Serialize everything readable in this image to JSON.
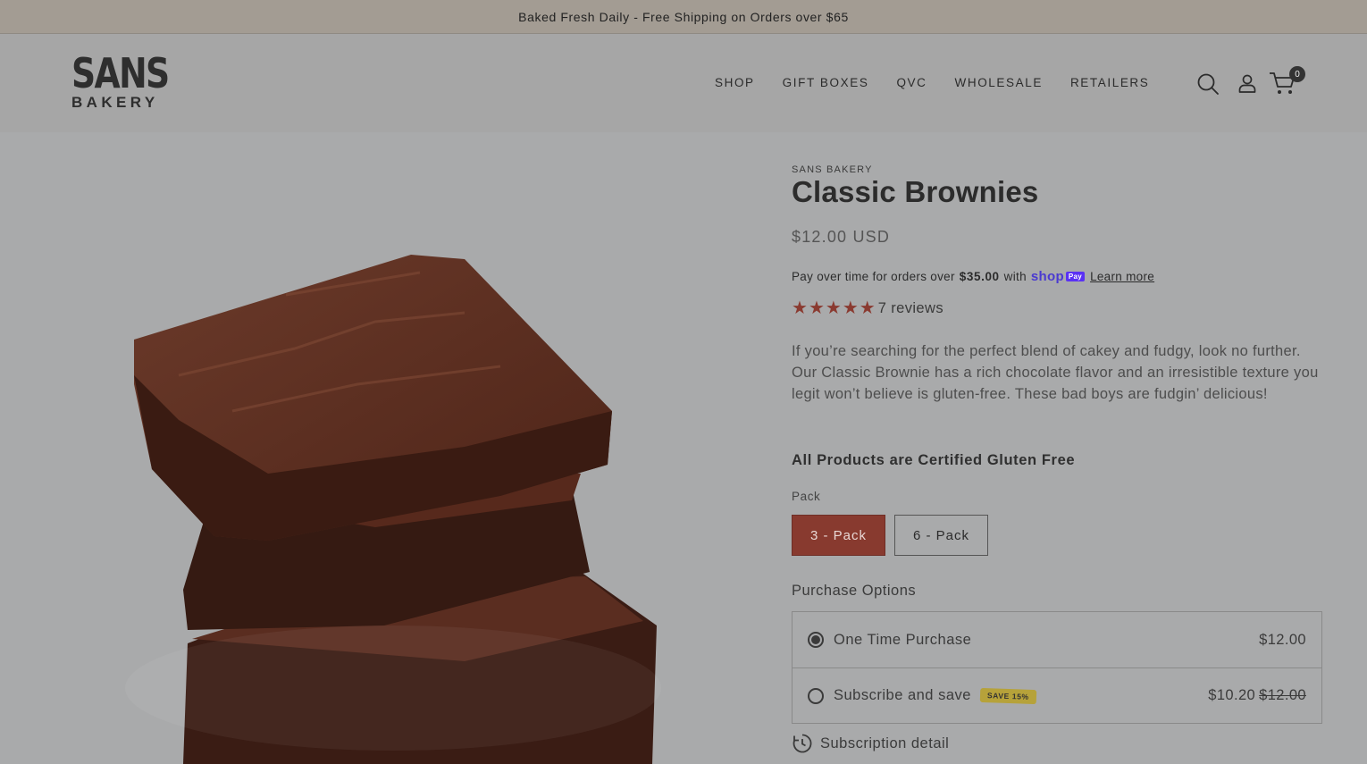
{
  "announcement": "Baked Fresh Daily - Free Shipping on Orders over $65",
  "logo": {
    "line1": "SANS",
    "line2": "BAKERY"
  },
  "nav": [
    "SHOP",
    "GIFT BOXES",
    "QVC",
    "WHOLESALE",
    "RETAILERS"
  ],
  "cart": {
    "count": "0"
  },
  "product": {
    "vendor": "SANS BAKERY",
    "title": "Classic Brownies",
    "price": "$12.00 USD",
    "pay_text_pre": "Pay over time for orders over",
    "pay_amount": "$35.00",
    "pay_text_with": "with",
    "shop_pay": "shop",
    "shop_pay_badge": "Pay",
    "learn_more": "Learn more",
    "rating": 5,
    "reviews": "7 reviews",
    "description": "If you’re searching for the perfect blend of cakey and fudgy, look no further. Our Classic Brownie has a rich chocolate flavor and an irresistible texture you legit won’t believe is gluten-free. These bad boys are fudgin’ delicious!",
    "certified": "All Products are Certified Gluten Free",
    "pack_label": "Pack",
    "packs": [
      "3 - Pack",
      "6 - Pack"
    ],
    "selected_pack": "3 - Pack"
  },
  "purchase": {
    "label": "Purchase Options",
    "one_time": {
      "label": "One Time Purchase",
      "price": "$12.00",
      "selected": true
    },
    "subscribe": {
      "label": "Subscribe and save",
      "tag": "SAVE 15%",
      "price": "$10.20",
      "old_price": "$12.00",
      "selected": false
    },
    "detail": "Subscription detail"
  },
  "colors": {
    "accent": "#883a2f",
    "overlay_bg": "#a9aaab"
  }
}
